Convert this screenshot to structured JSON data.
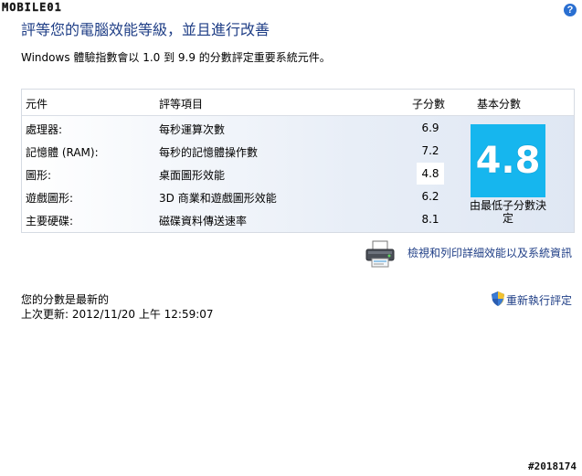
{
  "watermark": "MOBILE01",
  "header": {
    "title": "評等您的電腦效能等級，並且進行改善",
    "subtitle": "Windows 體驗指數會以 1.0 到 9.9 的分數評定重要系統元件。",
    "help_icon": "help-icon",
    "help_glyph": "?"
  },
  "table": {
    "headers": {
      "component": "元件",
      "rating": "評等項目",
      "subscore": "子分數",
      "basescore": "基本分數"
    },
    "rows": [
      {
        "component": "處理器:",
        "rating": "每秒運算次數",
        "subscore": "6.9"
      },
      {
        "component": "記憶體 (RAM):",
        "rating": "每秒的記憶體操作數",
        "subscore": "7.2"
      },
      {
        "component": "圖形:",
        "rating": "桌面圖形效能",
        "subscore": "4.8"
      },
      {
        "component": "遊戲圖形:",
        "rating": "3D 商業和遊戲圖形效能",
        "subscore": "6.2"
      },
      {
        "component": "主要硬碟:",
        "rating": "磁碟資料傳送速率",
        "subscore": "8.1"
      }
    ],
    "base_score": "4.8",
    "base_note": "由最低子分數決定",
    "base_color": "#16b6ee"
  },
  "links": {
    "details": "檢視和列印詳細效能以及系統資訊",
    "details_icon": "printer-icon",
    "rerun": "重新執行評定",
    "rerun_icon": "shield-icon"
  },
  "status": {
    "line1": "您的分數是最新的",
    "line2": "上次更新: 2012/11/20 上午 12:59:07"
  },
  "stamp": "#2018174"
}
